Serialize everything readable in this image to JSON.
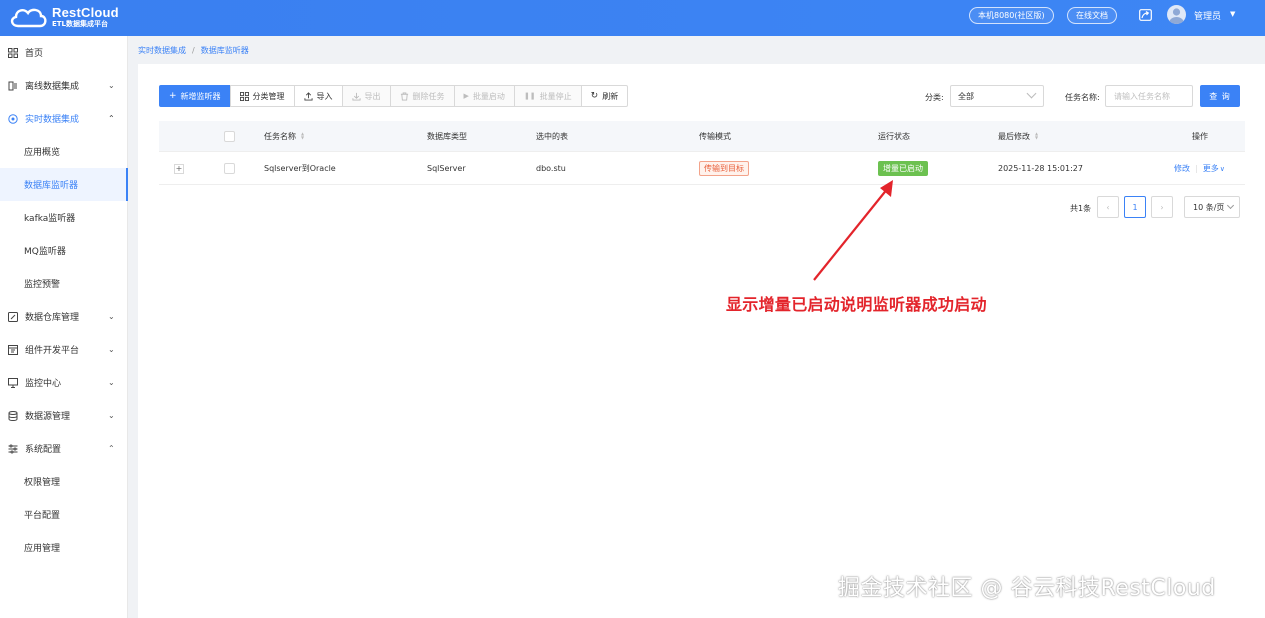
{
  "header": {
    "logo_title": "RestCloud",
    "logo_subtitle": "ETL数据集成平台",
    "host_label": "本机8080(社区版)",
    "docs_label": "在线文档",
    "user_name": "管理员",
    "accent_color": "#3b82f6"
  },
  "sidebar": {
    "items": [
      {
        "label": "首页",
        "icon": "grid-icon"
      },
      {
        "label": "离线数据集成",
        "icon": "offline-icon",
        "arrow": "⌄"
      },
      {
        "label": "实时数据集成",
        "icon": "realtime-icon",
        "arrow": "⌃"
      },
      {
        "label": "应用概览"
      },
      {
        "label": "数据库监听器"
      },
      {
        "label": "kafka监听器"
      },
      {
        "label": "MQ监听器"
      },
      {
        "label": "监控预警"
      },
      {
        "label": "数据仓库管理",
        "icon": "warehouse-icon",
        "arrow": "⌄"
      },
      {
        "label": "组件开发平台",
        "icon": "component-icon",
        "arrow": "⌄"
      },
      {
        "label": "监控中心",
        "icon": "monitor-icon",
        "arrow": "⌄"
      },
      {
        "label": "数据源管理",
        "icon": "database-icon",
        "arrow": "⌄"
      },
      {
        "label": "系统配置",
        "icon": "settings-icon",
        "arrow": "⌃"
      },
      {
        "label": "权限管理"
      },
      {
        "label": "平台配置"
      },
      {
        "label": "应用管理"
      }
    ]
  },
  "breadcrumb": {
    "parent": "实时数据集成",
    "separator": "/",
    "current": "数据库监听器"
  },
  "toolbar": {
    "add": "新增监听器",
    "category": "分类管理",
    "import": "导入",
    "export": "导出",
    "delete": "删除任务",
    "batch_start": "批量启动",
    "batch_stop": "批量停止",
    "refresh": "刷新"
  },
  "filters": {
    "category_label": "分类:",
    "category_value": "全部",
    "task_name_label": "任务名称:",
    "task_name_placeholder": "请输入任务名称",
    "query_button": "查 询"
  },
  "table": {
    "headers": [
      "任务名称",
      "数据库类型",
      "选中的表",
      "传输模式",
      "运行状态",
      "最后修改",
      "操作"
    ],
    "rows": [
      {
        "expand": "+",
        "name": "Sqlserver到Oracle",
        "db_type": "SqlServer",
        "table": "dbo.stu",
        "mode": "传输到目标",
        "status": "增量已启动",
        "modified": "2025-11-28 15:01:27",
        "edit": "修改",
        "more": "更多"
      }
    ]
  },
  "pagination": {
    "total": "共1条",
    "prev": "‹",
    "page": "1",
    "next": "›",
    "page_size": "10 条/页"
  },
  "annotation": {
    "text": "显示增量已启动说明监听器成功启动",
    "color": "#e3242b"
  },
  "watermark": "掘金技术社区 @ 谷云科技RestCloud"
}
